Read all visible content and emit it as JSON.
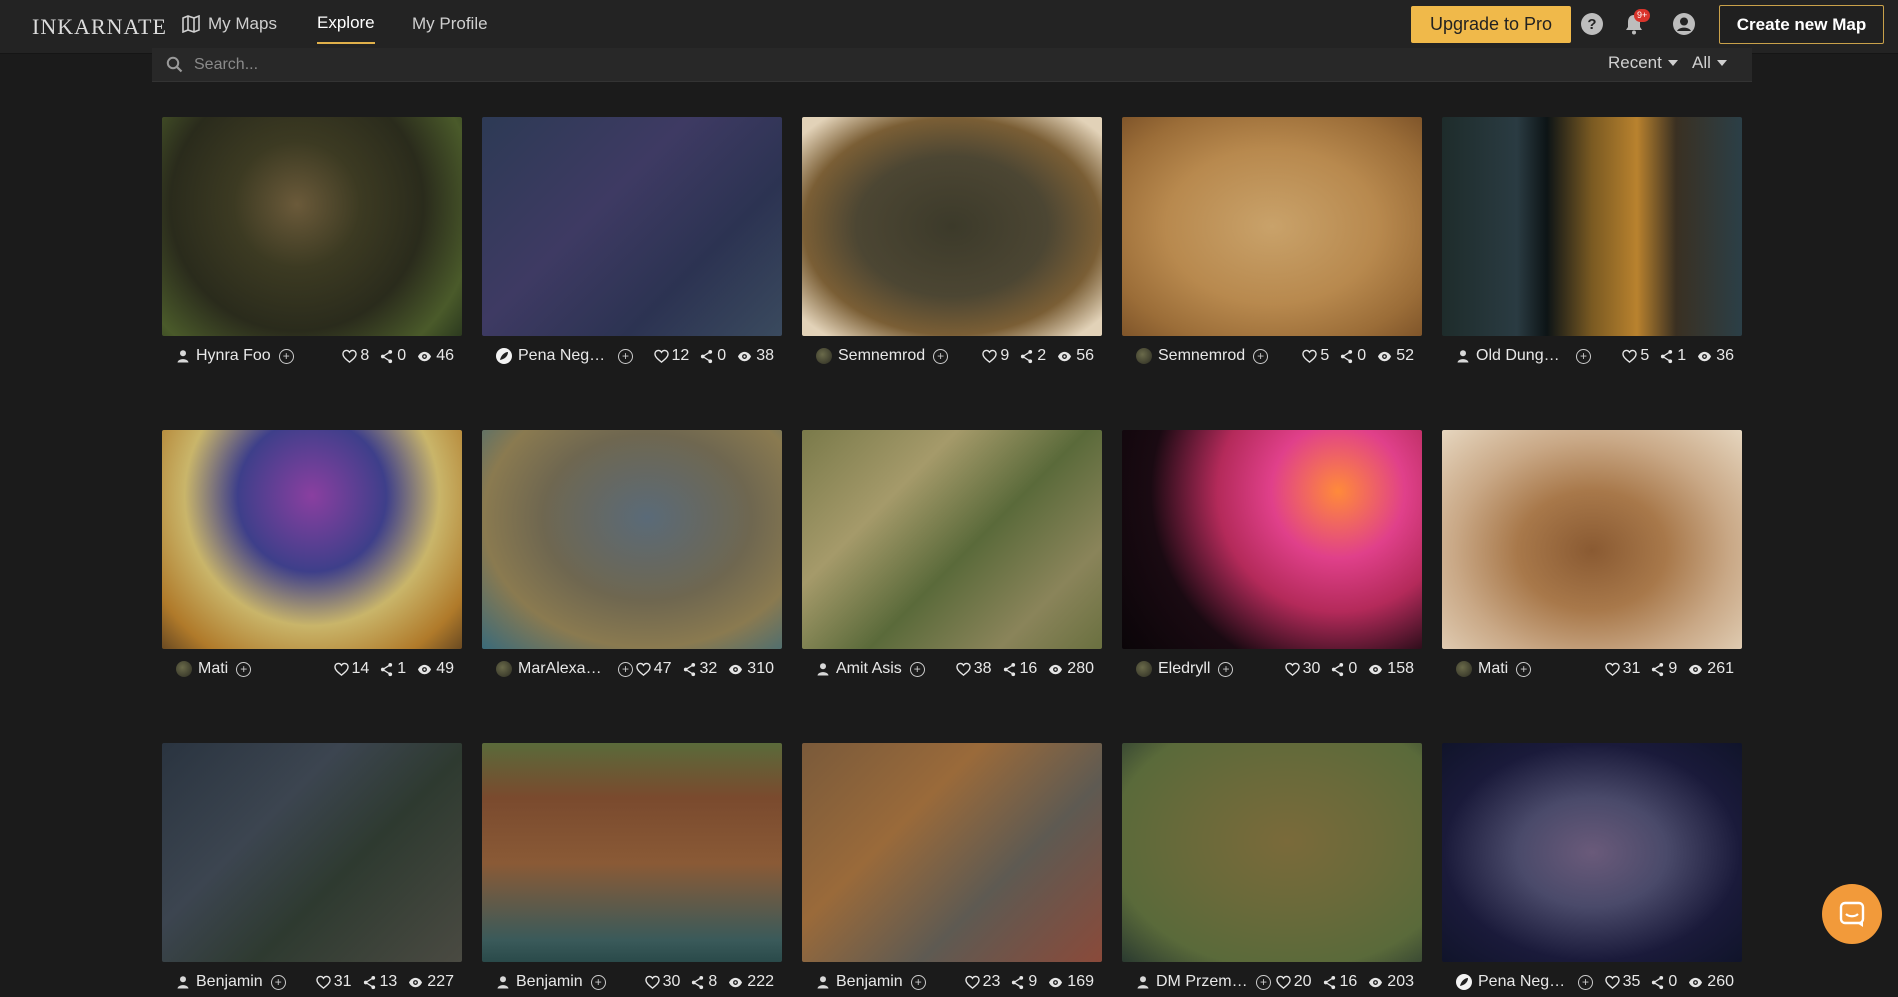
{
  "app": {
    "logo": "INKARNATE",
    "nav": [
      {
        "label": "My Maps",
        "icon": "map-icon"
      },
      {
        "label": "Explore",
        "active": true
      },
      {
        "label": "My Profile"
      }
    ],
    "upgrade_label": "Upgrade to Pro",
    "notification_badge": "9+",
    "create_label": "Create new Map"
  },
  "search": {
    "placeholder": "Search...",
    "sort": "Recent",
    "filter": "All"
  },
  "colors": {
    "accent": "#f0b94a",
    "background": "#1b1b1b",
    "topbar": "#232323",
    "chat": "#f29a3a"
  },
  "maps": [
    {
      "author": "Hynra Foo",
      "avatar": "person-icon",
      "likes": "8",
      "shares": "0",
      "views": "46",
      "bg": "radial-gradient(circle at 45% 40%, #6b5a3a 0%, #3c3a22 30%, #2a2b1c 60%, #4a5a2a 85%, #2c3a1f 100%)"
    },
    {
      "author": "Pena Negra Maps",
      "avatar": "logo-avatar",
      "likes": "12",
      "shares": "0",
      "views": "38",
      "bg": "linear-gradient(135deg, #2d3a55 0%, #3e3a63 40%, #2c3352 70%, #3a4a5e 100%)"
    },
    {
      "author": "Semnemrod",
      "avatar": "image-avatar",
      "likes": "9",
      "shares": "2",
      "views": "56",
      "bg": "radial-gradient(ellipse at 50% 50%, #3c3a2a 0%, #4c4633 45%, #7a5e35 70%, #e2d2b8 92%)"
    },
    {
      "author": "Semnemrod",
      "avatar": "image-avatar",
      "likes": "5",
      "shares": "0",
      "views": "52",
      "bg": "radial-gradient(ellipse at 50% 50%, #c9a26a 0%, #b8894e 50%, #9b6d38 80%, #7f552a 100%)"
    },
    {
      "author": "Old Dungeon Maps",
      "avatar": "person-icon",
      "likes": "5",
      "shares": "1",
      "views": "36",
      "bg": "linear-gradient(90deg, #1e2c2b 0%, #2a3b42 25%, #0d1416 35%, #7a5a22 50%, #b9822e 65%, #3a3022 78%, #2b3f47 100%)"
    },
    {
      "author": "Mati",
      "avatar": "image-avatar",
      "likes": "14",
      "shares": "1",
      "views": "49",
      "bg": "radial-gradient(ellipse at 50% 30%, #8a3fa0 0%, #3e3f8a 35%, #c9b56a 60%, #b07a2a 85%, #6a4a22 100%)"
    },
    {
      "author": "MarAlexandria",
      "avatar": "image-avatar",
      "likes": "47",
      "shares": "32",
      "views": "310",
      "bg": "radial-gradient(ellipse at 55% 40%, #5a6a78 0%, #6f6750 45%, #8a7a50 70%, #3a6a7a 100%)"
    },
    {
      "author": "Amit Asis",
      "avatar": "person-icon",
      "likes": "38",
      "shares": "16",
      "views": "280",
      "bg": "linear-gradient(135deg, #7a7a4a 0%, #a59a6a 30%, #5a6a3a 55%, #8a845a 80%, #6a7040 100%)"
    },
    {
      "author": "Eledryll",
      "avatar": "image-avatar",
      "likes": "30",
      "shares": "0",
      "views": "158",
      "bg": "radial-gradient(circle at 72% 28%, #ff8a3a 0%, #e0408a 25%, #b42a5a 45%, #1a0a12 70%, #0a0508 100%)"
    },
    {
      "author": "Mati",
      "avatar": "image-avatar",
      "likes": "31",
      "shares": "9",
      "views": "261",
      "bg": "radial-gradient(ellipse at 50% 55%, #8a5a32 0%, #a8784a 35%, #c9a886 65%, #e6d6bf 100%)"
    },
    {
      "author": "Benjamin",
      "avatar": "person-icon",
      "likes": "31",
      "shares": "13",
      "views": "227",
      "bg": "linear-gradient(135deg, #2a3440 0%, #3c4550 35%, #2e3a30 60%, #4a4a42 100%)"
    },
    {
      "author": "Benjamin",
      "avatar": "person-icon",
      "likes": "30",
      "shares": "8",
      "views": "222",
      "bg": "linear-gradient(180deg, #5a6a3a 0%, #7a4a2e 25%, #8a5a36 55%, #3a5a5a 90%, #2a4a4a 100%)"
    },
    {
      "author": "Benjamin",
      "avatar": "person-icon",
      "likes": "23",
      "shares": "9",
      "views": "169",
      "bg": "linear-gradient(135deg, #7a5a3a 0%, #9a6a3a 35%, #5e5a52 65%, #8a4a3a 100%)"
    },
    {
      "author": "DM Przemek",
      "avatar": "person-icon",
      "likes": "20",
      "shares": "16",
      "views": "203",
      "bg": "radial-gradient(ellipse at 55% 45%, #7a6a3a 0%, #6a6a3a 40%, #5a6a3a 75%, #2a3a30 100%)"
    },
    {
      "author": "Pena Negra Maps",
      "avatar": "logo-avatar",
      "likes": "35",
      "shares": "0",
      "views": "260",
      "bg": "radial-gradient(ellipse at 50% 50%, #6a5a7a 0%, #4a4a6a 35%, #1a1a3a 70%, #10142a 100%)"
    }
  ],
  "stat_icons": [
    "heart-icon",
    "share-icon",
    "eye-icon"
  ],
  "chat_icon": "chat-icon"
}
